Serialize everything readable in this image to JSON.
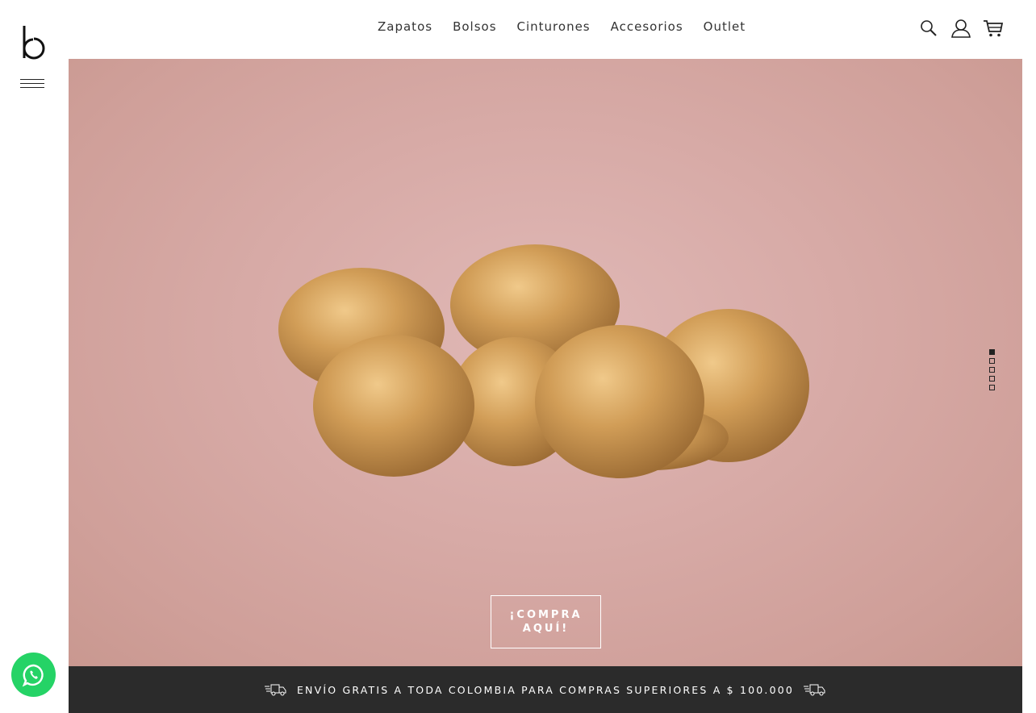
{
  "brand": {
    "logo_icon": "brand-b-logo",
    "menu_icon": "hamburger-icon"
  },
  "nav": {
    "items": [
      {
        "label": "Zapatos"
      },
      {
        "label": "Bolsos"
      },
      {
        "label": "Cinturones"
      },
      {
        "label": "Accesorios"
      },
      {
        "label": "Outlet"
      }
    ]
  },
  "header_icons": [
    "search-icon",
    "user-icon",
    "cart-icon"
  ],
  "hero": {
    "cta_label": "¡COMPRA AQUÍ!",
    "background_color": "#d7aaa6",
    "slider": {
      "total": 5,
      "active": 1
    }
  },
  "shipping_bar": {
    "text": "ENVÍO GRATIS A TODA COLOMBIA PARA COMPRAS SUPERIORES A $ 100.000",
    "icon": "truck-icon",
    "background_color": "#2b2b2b"
  },
  "whatsapp": {
    "icon": "whatsapp-icon",
    "color": "#25d366"
  }
}
